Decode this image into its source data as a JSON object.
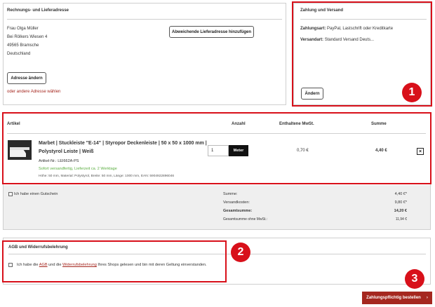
{
  "address": {
    "title": "Rechnungs- und Lieferadresse",
    "name": "Frau Olga Müller",
    "street": "Bei Rölkers Wiesen 4",
    "city": "49565 Bramsche",
    "country": "Deutschland",
    "change_button": "Adresse ändern",
    "other_address_link": "oder andere Adresse wählen",
    "add_delivery_button": "Abweichende Lieferadresse hinzufügen"
  },
  "payment": {
    "title": "Zahlung und Versand",
    "payment_label": "Zahlungsart:",
    "payment_value": "PayPal, Lastschrift oder Kreditkarte",
    "shipping_label": "Versandart:",
    "shipping_value": "Standard Versand Deuts...",
    "change_button": "Ändern"
  },
  "cart": {
    "headers": {
      "article": "Artikel",
      "quantity": "Anzahl",
      "vat": "Enthaltene MwSt.",
      "sum": "Summe"
    },
    "item": {
      "title_line1": "Marbet | Stuckleiste \"E-14\" | Styropor Deckenleiste | 50 x 50 x 1000 mm |",
      "title_line2": "Polystyrol Leiste | Weiß",
      "article_no": "Artikel-Nr.: LEI662A-PS",
      "availability": "Sofort versandfertig, Lieferzeit ca. 2 Werktage",
      "details": "Höhe: 50 mm, Material: Polystyrol, Breite: 50 mm, Länge: 1000 mm, EAN: 5904922896046",
      "quantity": "1",
      "unit": "Meter",
      "vat": "0,70 €",
      "sum": "4,40 €",
      "remove_icon": "close-icon"
    },
    "voucher_label": "Ich habe einen Gutschein",
    "totals": [
      {
        "label": "Summe:",
        "value": "4,40 €*"
      },
      {
        "label": "Versandkosten:",
        "value": "9,80 €*"
      },
      {
        "label": "Gesamtsumme:",
        "value": "14,20 €"
      },
      {
        "label": "Gesamtsumme ohne MwSt.:",
        "value": "11,94 €"
      }
    ]
  },
  "terms": {
    "title": "AGB und Widerrufsbelehrung",
    "text_before": "Ich habe die ",
    "agb_link": "AGB",
    "text_middle": " und die ",
    "widerruf_link": "Widerrufsbelehrung",
    "text_after": " Ihres Shops gelesen und bin mit deren Geltung einverstanden."
  },
  "order_button": "Zahlungspflichtig bestellen",
  "order_button_icon": "chevron-right-icon",
  "badges": [
    "1",
    "2",
    "3"
  ],
  "colors": {
    "accent": "#a5271f",
    "highlight": "#d8101a",
    "availability": "#5cae42"
  }
}
